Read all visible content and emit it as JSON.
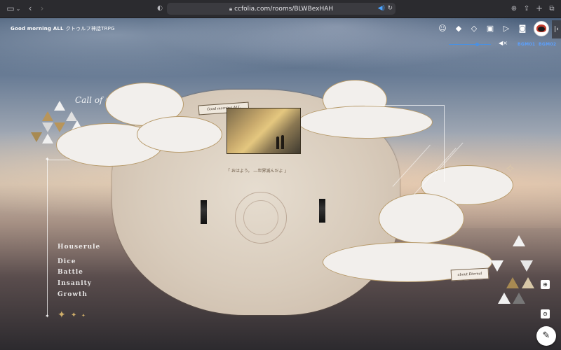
{
  "browser": {
    "url": "ccfolia.com/rooms/BLWBexHAH",
    "icons": [
      "sidebar-icon",
      "chevron-down-icon",
      "back-icon",
      "forward-icon",
      "shield-icon",
      "download-icon",
      "share-icon",
      "new-tab-icon",
      "tabs-icon"
    ]
  },
  "room": {
    "title": "Good morning ALL",
    "subtitle": "クトゥルフ神話TRPG"
  },
  "header_icons": [
    "face-icon",
    "layers-icon",
    "layers-outline-icon",
    "add-photo-icon",
    "video-icon",
    "cat-icon",
    "user-avatar"
  ],
  "bgm": {
    "label1": "BGM01",
    "label2": "BGM02",
    "accent_color": "#5aa0ff"
  },
  "map": {
    "title_script": "Call of Cthulhu",
    "banner": "Good morning ALL",
    "quote": "「 おはよう。 ―世界滅んだよ 」",
    "sign": "about Eternal"
  },
  "menu": [
    "Houserule",
    "Dice",
    "Battle",
    "Insanity",
    "Growth"
  ],
  "controls": {
    "zoom_in": "+",
    "zoom_out": "−",
    "edit_icon": "pencil-icon"
  }
}
